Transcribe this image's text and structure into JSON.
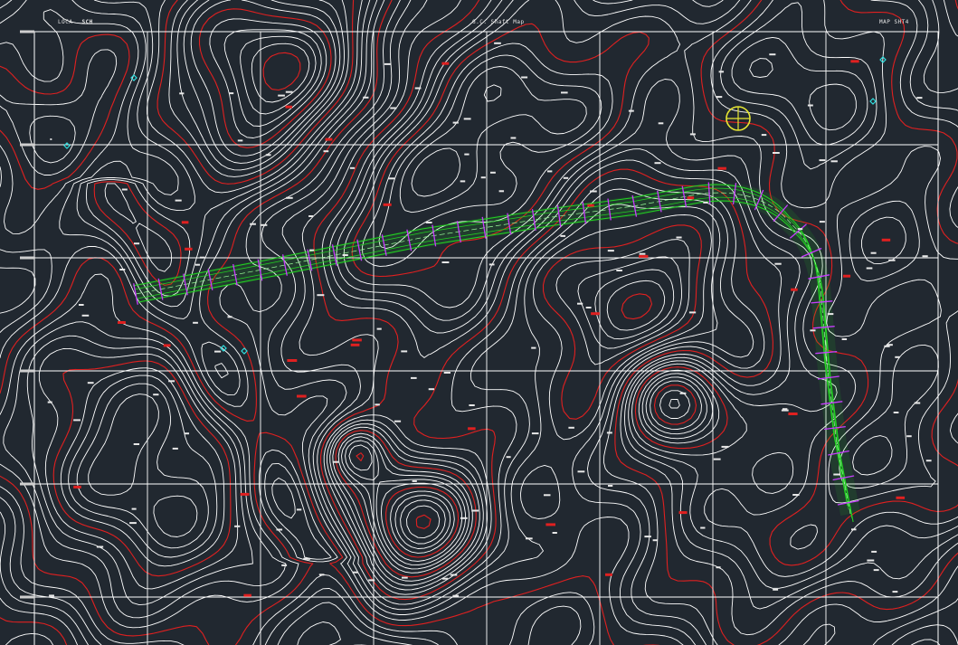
{
  "header": {
    "left_label": "LOCA",
    "left_scale": "SCH",
    "center_label": "G.C. Shaft Map",
    "right_label": "MAP",
    "right_sheet": "SHT4"
  },
  "colors": {
    "background": "#212830",
    "grid": "#ffffff",
    "minor_contour": "#ffffff",
    "index_contour": "#e02020",
    "alignment_edge": "#22d022",
    "alignment_center": "#9aff9a",
    "stations": "#c83cff",
    "cyan_markers": "#30e0e0",
    "north_marker": "#e6e633"
  },
  "layers": [
    "grid",
    "contours-minor",
    "contours-index",
    "alignment",
    "station-ticks",
    "survey-markers",
    "north-marker"
  ]
}
